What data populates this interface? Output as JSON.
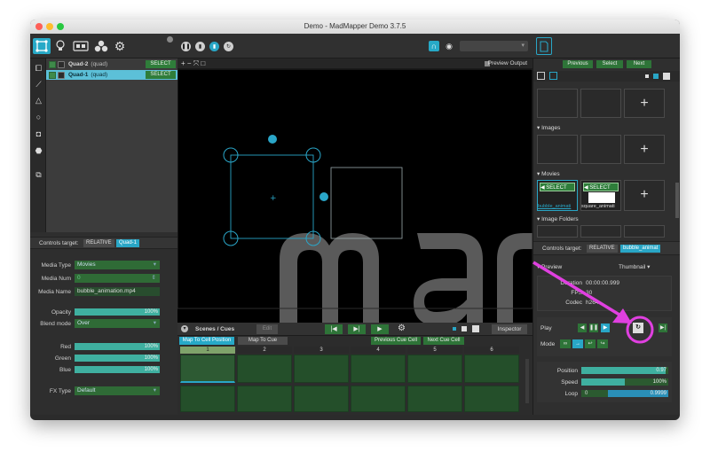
{
  "window": {
    "title": "Demo - MadMapper Demo 3.7.5"
  },
  "toolbar": {
    "icons": [
      "surfaces-icon",
      "bulb-icon",
      "output-icon",
      "fixtures-icon",
      "gear-icon",
      "play-icon",
      "pause-icon",
      "stop-icon",
      "record-icon",
      "refresh-icon",
      "magnet-icon",
      "eye-icon",
      "file-icon"
    ],
    "dropdown_value": ""
  },
  "surfaces": [
    {
      "name": "Quad-2",
      "type": "(quad)",
      "select_label": "SELECT"
    },
    {
      "name": "Quad-1",
      "type": "(quad)",
      "select_label": "SELECT"
    }
  ],
  "controls_target": {
    "label": "Controls target:",
    "mode": "RELATIVE",
    "target": "Quad-1"
  },
  "media": {
    "type_label": "Media Type",
    "type_value": "Movies",
    "num_label": "Media Num",
    "num_value": "0",
    "name_label": "Media Name",
    "name_value": "bubble_animation.mp4"
  },
  "opacity": {
    "label": "Opacity",
    "value": "100%",
    "fraction": 1.0
  },
  "blend": {
    "label": "Blend mode",
    "value": "Over"
  },
  "colors": [
    {
      "label": "Red",
      "value": "100%"
    },
    {
      "label": "Green",
      "value": "100%"
    },
    {
      "label": "Blue",
      "value": "100%"
    }
  ],
  "fx": {
    "label": "FX Type",
    "value": "Default"
  },
  "viewport_header": {
    "tools": "+ − ⤧ □",
    "preview_output": "Preview Output"
  },
  "scenes": {
    "title": "Scenes / Cues",
    "edit_label": "Edit",
    "inspector_label": "Inspector",
    "map_cell_label": "Map To Cell Position",
    "map_cue_label": "Map To Cue",
    "prev_cell_label": "Previous Cue Cell",
    "next_cell_label": "Next Cue Cell",
    "columns": [
      "1",
      "2",
      "3",
      "4",
      "5",
      "6"
    ]
  },
  "right": {
    "nav": {
      "previous": "Previous",
      "select": "Select",
      "next": "Next"
    },
    "sections": {
      "images": "Images",
      "movies": "Movies",
      "image_folders": "Image Folders"
    },
    "movies": [
      {
        "select_label": "SELECT",
        "name": "bubble_animati"
      },
      {
        "select_label": "SELECT",
        "name": "square_animati"
      }
    ],
    "controls_target": {
      "label": "Controls target:",
      "mode": "RELATIVE",
      "target": "bubble_animat"
    },
    "preview": {
      "label": "Preview",
      "mode": "Thumbnail"
    },
    "info": {
      "duration_label": "Duration",
      "duration_value": "00:00:00.999",
      "fps_label": "FPS",
      "fps_value": "30",
      "codec_label": "Codec",
      "codec_value": "h264"
    },
    "play_label": "Play",
    "mode_label": "Mode",
    "position": {
      "label": "Position",
      "value": "0.97",
      "fraction": 0.97
    },
    "speed": {
      "label": "Speed",
      "value": "100%",
      "fraction": 0.5
    },
    "loop": {
      "label": "Loop",
      "start": "0",
      "end": "0.9999"
    }
  },
  "annotation_color": "#e040e0"
}
